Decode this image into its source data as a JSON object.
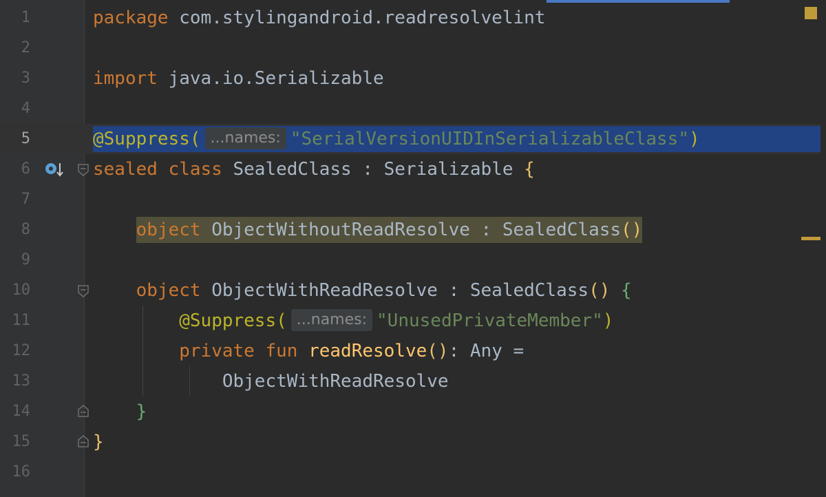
{
  "editor": {
    "lines": [
      {
        "n": "1"
      },
      {
        "n": "2"
      },
      {
        "n": "3"
      },
      {
        "n": "4"
      },
      {
        "n": "5"
      },
      {
        "n": "6"
      },
      {
        "n": "7"
      },
      {
        "n": "8"
      },
      {
        "n": "9"
      },
      {
        "n": "10"
      },
      {
        "n": "11"
      },
      {
        "n": "12"
      },
      {
        "n": "13"
      },
      {
        "n": "14"
      },
      {
        "n": "15"
      },
      {
        "n": "16"
      }
    ],
    "code": {
      "l1_kw": "package",
      "l1_rest": " com.stylingandroid.readresolvelint",
      "l3_kw": "import",
      "l3_rest": " java.io.Serializable",
      "l5_anno": "@Suppress(",
      "l5_hint": "...names:",
      "l5_str": "\"SerialVersionUIDInSerializableClass\"",
      "l5_close": ")",
      "l6_kw": "sealed class",
      "l6_name": " SealedClass : Serializable ",
      "l6_brace": "{",
      "l8_indent": "    ",
      "l8_kw": "object",
      "l8_rest": " ObjectWithoutReadResolve : SealedClass",
      "l8_paren": "()",
      "l10_indent": "    ",
      "l10_kw": "object",
      "l10_rest": " ObjectWithReadResolve : SealedClass",
      "l10_paren": "() ",
      "l10_brace": "{",
      "l11_indent": "        ",
      "l11_anno": "@Suppress(",
      "l11_hint": "...names:",
      "l11_str": "\"UnusedPrivateMember\"",
      "l11_close": ")",
      "l12_indent": "        ",
      "l12_kw": "private fun",
      "l12_sp": " ",
      "l12_fn": "readResolve",
      "l12_paren": "()",
      "l12_rest": ": Any =",
      "l13_indent": "            ",
      "l13_rest": "ObjectWithReadResolve",
      "l14_indent": "    ",
      "l14_brace": "}",
      "l15_brace": "}"
    }
  },
  "colors": {
    "background": "#2b2b2b",
    "keyword": "#cc7832",
    "annotation": "#bbb529",
    "string": "#6a8759",
    "function": "#ffc66d",
    "selection": "#214283",
    "warning_marker": "#c09b3a"
  },
  "icons": {
    "gutter_line6": "implemented-by-icon",
    "fold": "fold-marker-icon"
  }
}
